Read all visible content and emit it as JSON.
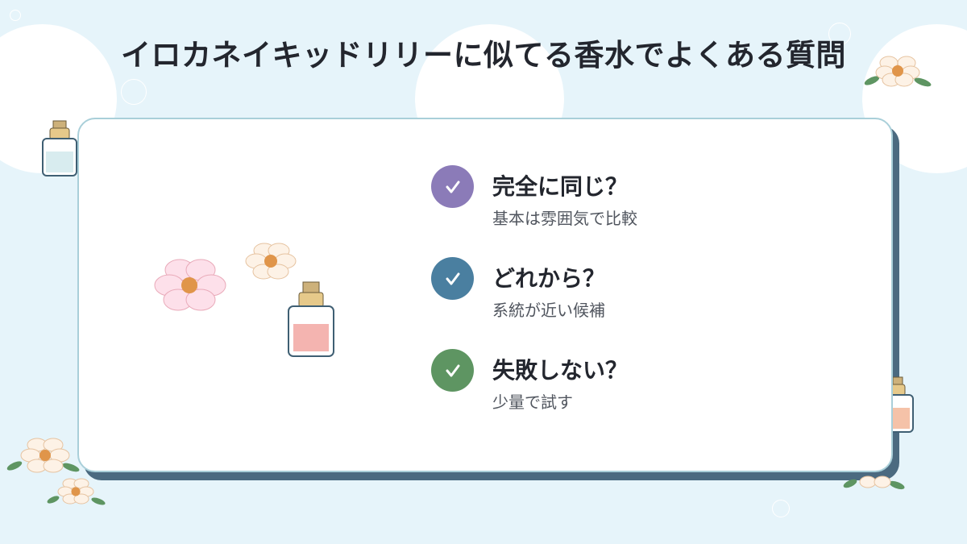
{
  "title": "イロカネイキッドリリーに似てる香水でよくある質問",
  "faq": [
    {
      "question": "完全に同じ？",
      "answer": "基本は雰囲気で比較",
      "color": "#8b7bb8"
    },
    {
      "question": "どれから？",
      "answer": "系統が近い候補",
      "color": "#4a7fa0"
    },
    {
      "question": "失敗しない？",
      "answer": "少量で試す",
      "color": "#5e9562"
    }
  ],
  "colors": {
    "background": "#e6f4fa",
    "card_shadow": "#4b6a80",
    "card_border": "#a9cfd9",
    "flower_center": "#e0954a",
    "leaf": "#5e9562"
  },
  "icons": [
    "check-icon",
    "flower-icon",
    "perfume-bottle-icon",
    "leaf-icon"
  ]
}
